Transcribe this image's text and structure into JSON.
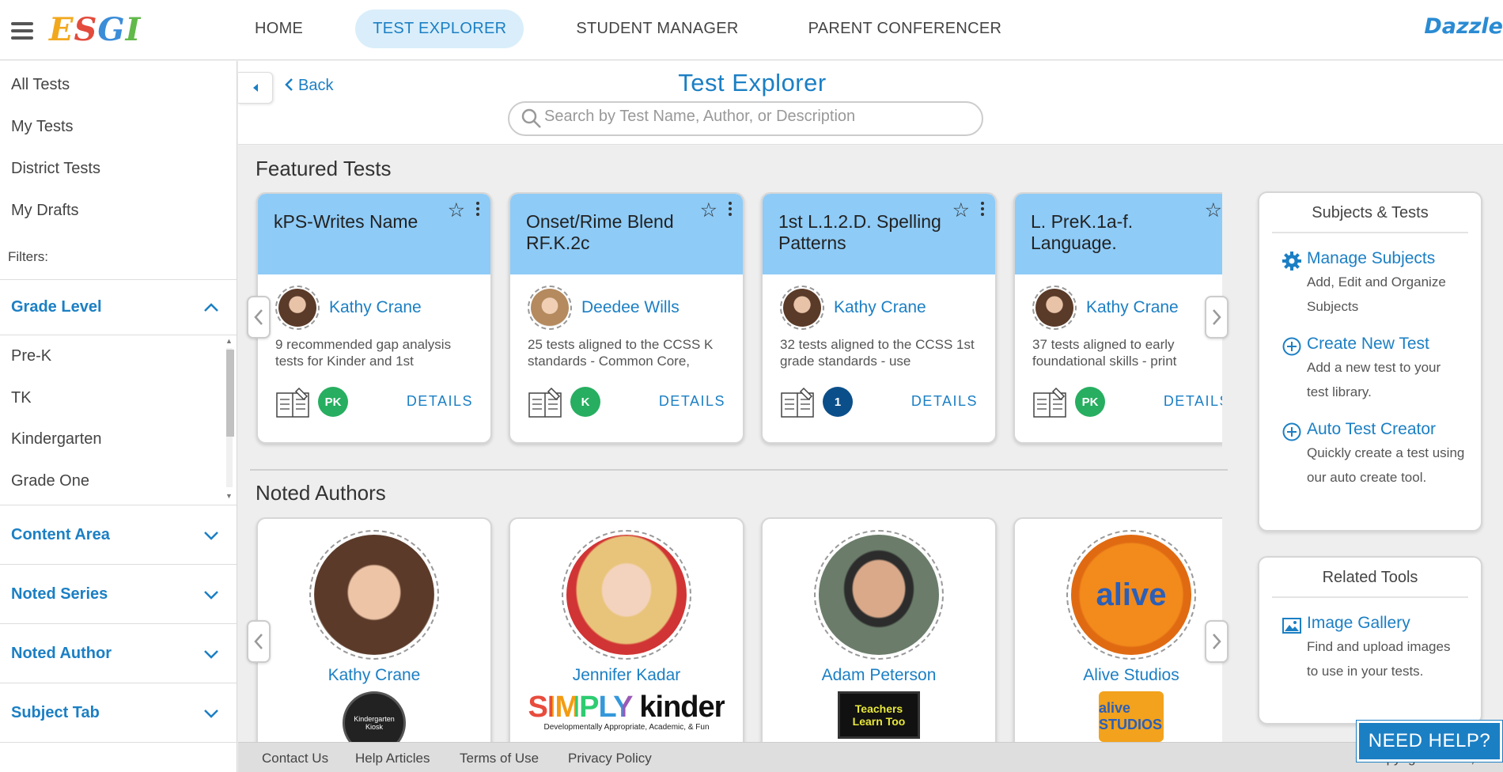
{
  "brand": {
    "logo_text": "ESGI",
    "partner_logo_text": "Dazzle"
  },
  "nav": {
    "items": [
      {
        "label": "HOME",
        "active": false
      },
      {
        "label": "TEST EXPLORER",
        "active": true
      },
      {
        "label": "STUDENT MANAGER",
        "active": false
      },
      {
        "label": "PARENT CONFERENCER",
        "active": false
      }
    ]
  },
  "sidebar": {
    "links": [
      "All Tests",
      "My Tests",
      "District Tests",
      "My Drafts"
    ],
    "filters_label": "Filters:",
    "grade_level": {
      "label": "Grade Level",
      "expanded": true,
      "options": [
        "Pre-K",
        "TK",
        "Kindergarten",
        "Grade One"
      ]
    },
    "collapsed_filters": [
      "Content Area",
      "Noted Series",
      "Noted Author",
      "Subject Tab"
    ]
  },
  "header": {
    "back_label": "Back",
    "title": "Test Explorer",
    "search_placeholder": "Search by Test Name, Author, or Description"
  },
  "featured": {
    "title": "Featured Tests",
    "cards": [
      {
        "title": "kPS-Writes Name",
        "author": "Kathy Crane",
        "description": "9 recommended gap analysis tests for Kinder and 1st",
        "grade": "PK",
        "grade_color": "#27ae60",
        "details_label": "DETAILS"
      },
      {
        "title": "Onset/Rime Blend RF.K.2c",
        "author": "Deedee Wills",
        "description": "25 tests aligned to the CCSS K standards - Common Core,",
        "grade": "K",
        "grade_color": "#27ae60",
        "details_label": "DETAILS"
      },
      {
        "title": "1st L.1.2.D. Spelling Patterns",
        "author": "Kathy Crane",
        "description": "32 tests aligned to the CCSS 1st grade standards - use",
        "grade": "1",
        "grade_color": "#0b4f8a",
        "details_label": "DETAILS"
      },
      {
        "title": "L. PreK.1a-f. Language.",
        "author": "Kathy Crane",
        "description": "37 tests aligned to early foundational skills - print",
        "grade": "PK",
        "grade_color": "#27ae60",
        "details_label": "DETAILS"
      }
    ]
  },
  "authors": {
    "title": "Noted Authors",
    "cards": [
      {
        "name": "Kathy Crane",
        "logo": "Kindergarten Kiosk"
      },
      {
        "name": "Jennifer Kadar",
        "logo": "SIMPLY kinder",
        "logo_tagline": "Developmentally Appropriate, Academic, & Fun"
      },
      {
        "name": "Adam Peterson",
        "logo": "Teachers Learn Too"
      },
      {
        "name": "Alive Studios",
        "logo": "alive STUDIOS"
      }
    ]
  },
  "subjects_panel": {
    "title": "Subjects & Tests",
    "items": [
      {
        "title": "Manage Subjects",
        "desc": "Add, Edit and Organize Subjects",
        "icon": "gear-icon"
      },
      {
        "title": "Create New Test",
        "desc": "Add a new test to your test library.",
        "icon": "plus-circle-icon"
      },
      {
        "title": "Auto Test Creator",
        "desc": "Quickly create a test using our auto create tool.",
        "icon": "plus-circle-icon"
      }
    ]
  },
  "tools_panel": {
    "title": "Related Tools",
    "items": [
      {
        "title": "Image Gallery",
        "desc": "Find and upload images to use in your tests.",
        "icon": "image-icon"
      }
    ]
  },
  "footer": {
    "links": [
      "Contact Us",
      "Help Articles",
      "Terms of Use",
      "Privacy Policy"
    ],
    "copyright": "© Copyright - ESGI, LLC"
  },
  "help_button": "NEED HELP?",
  "colors": {
    "accent": "#1b7fc4",
    "card_header": "#8ecbf7",
    "nav_active_bg": "#d9eefa"
  }
}
